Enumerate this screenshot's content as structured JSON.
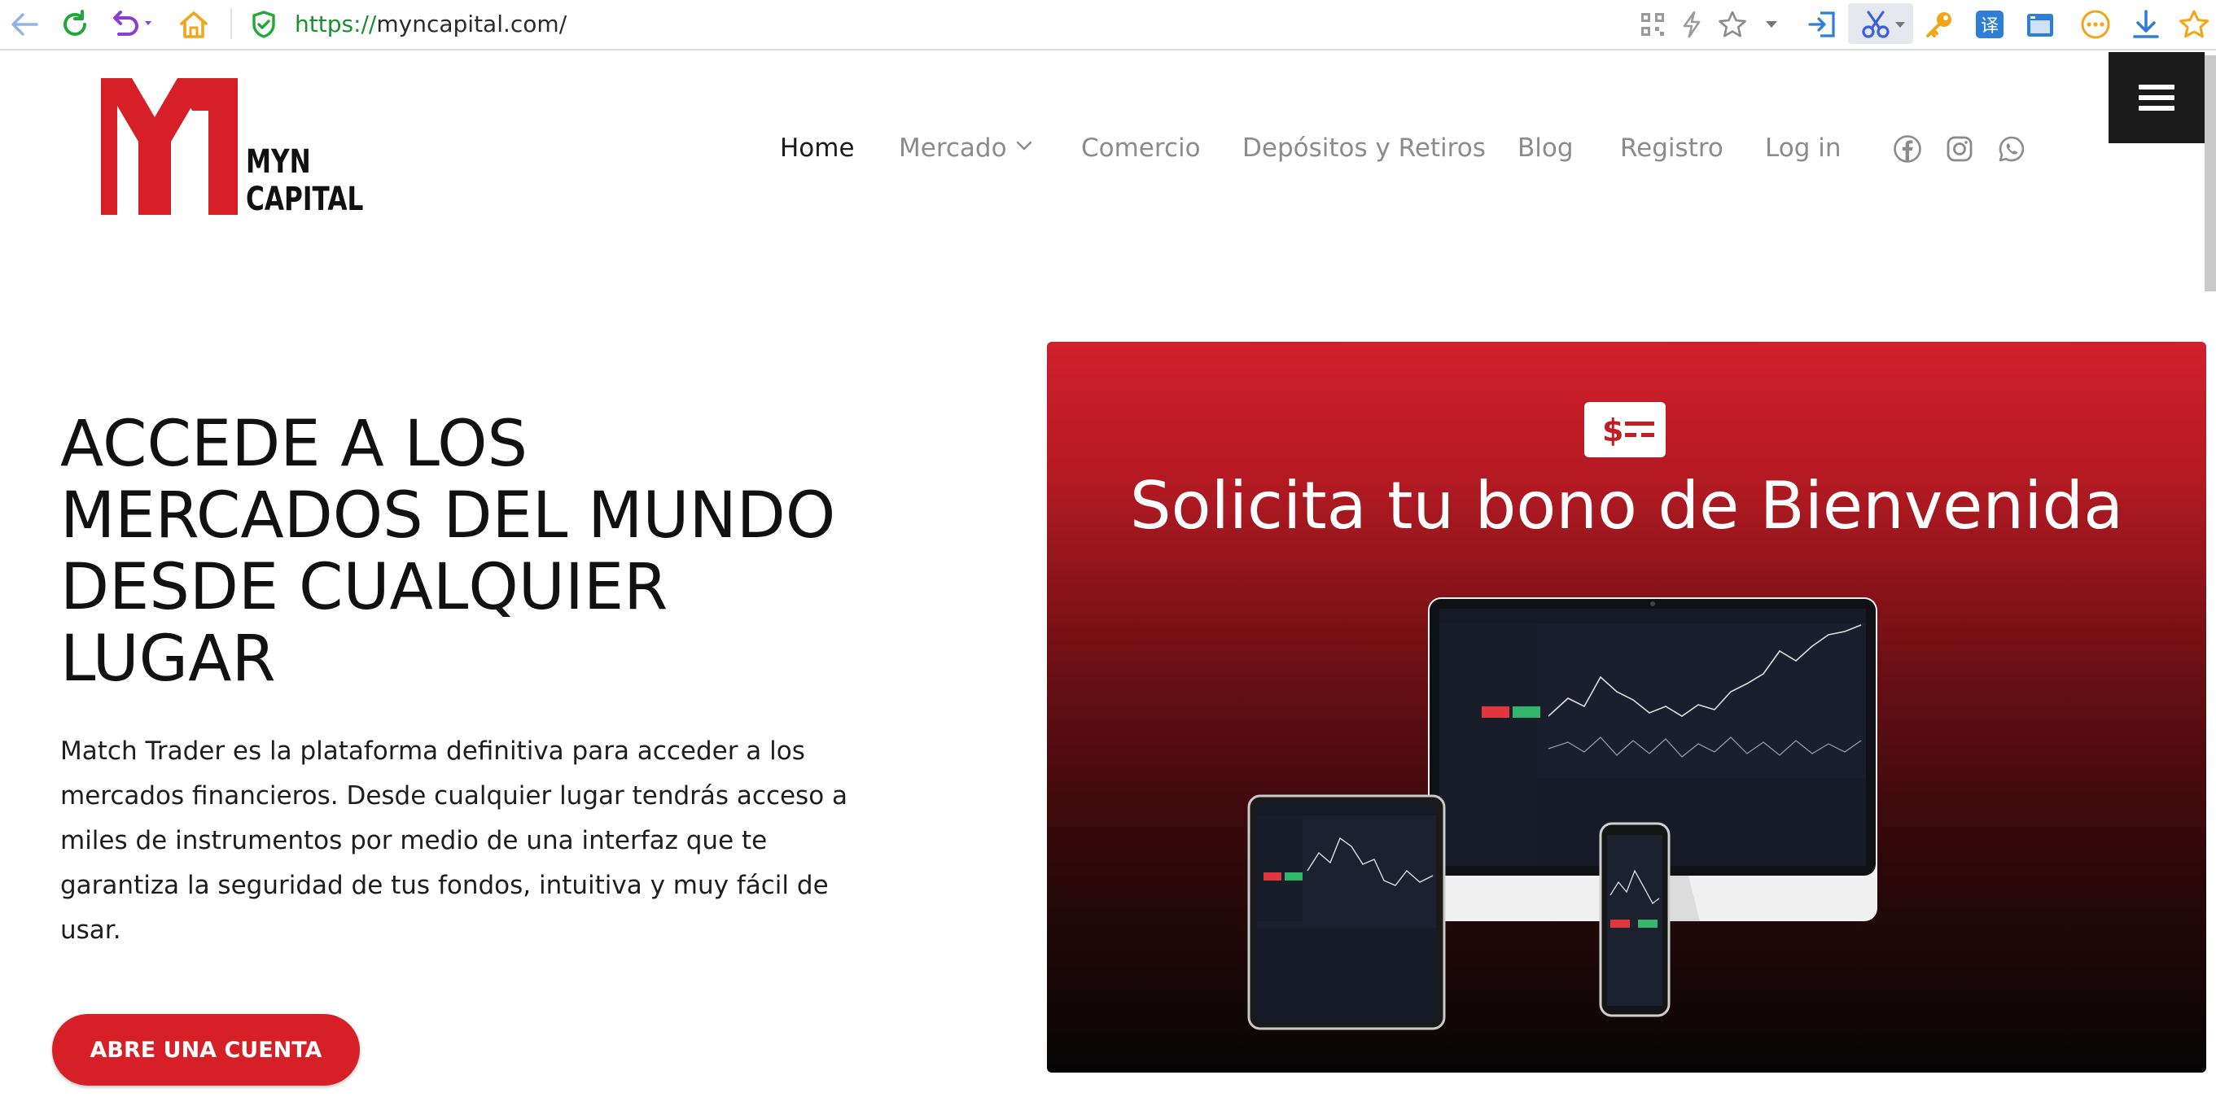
{
  "browser": {
    "url_scheme": "https://",
    "url_host": "myncapital.com/"
  },
  "logo": {
    "line1": "MYN",
    "line2": "CAPITAL"
  },
  "nav": {
    "items": [
      "Home",
      "Mercado",
      "Comercio",
      "Depósitos y Retiros",
      "Blog",
      "Registro",
      "Log in"
    ],
    "active_index": 0
  },
  "social_icons": [
    "facebook-icon",
    "instagram-icon",
    "whatsapp-icon"
  ],
  "hero": {
    "title_lines": [
      "ACCEDE A LOS",
      "MERCADOS DEL MUNDO",
      "DESDE CUALQUIER",
      "LUGAR"
    ],
    "paragraph": "Match Trader  es la plataforma definitiva para acceder a los mercados financieros. Desde cualquier lugar tendrás acceso a miles de instrumentos por medio de una interfaz que te garantiza la seguridad de tus fondos, intuitiva y muy fácil de usar.",
    "cta_label": "ABRE UNA CUENTA"
  },
  "banner": {
    "title": "Solicita tu bono de Bienvenida",
    "icon_text": "$"
  },
  "colors": {
    "brand_red": "#d61f26",
    "url_green": "#1a8f2e",
    "nav_inactive": "#8b8b8b",
    "dark": "#1b1b1b"
  }
}
